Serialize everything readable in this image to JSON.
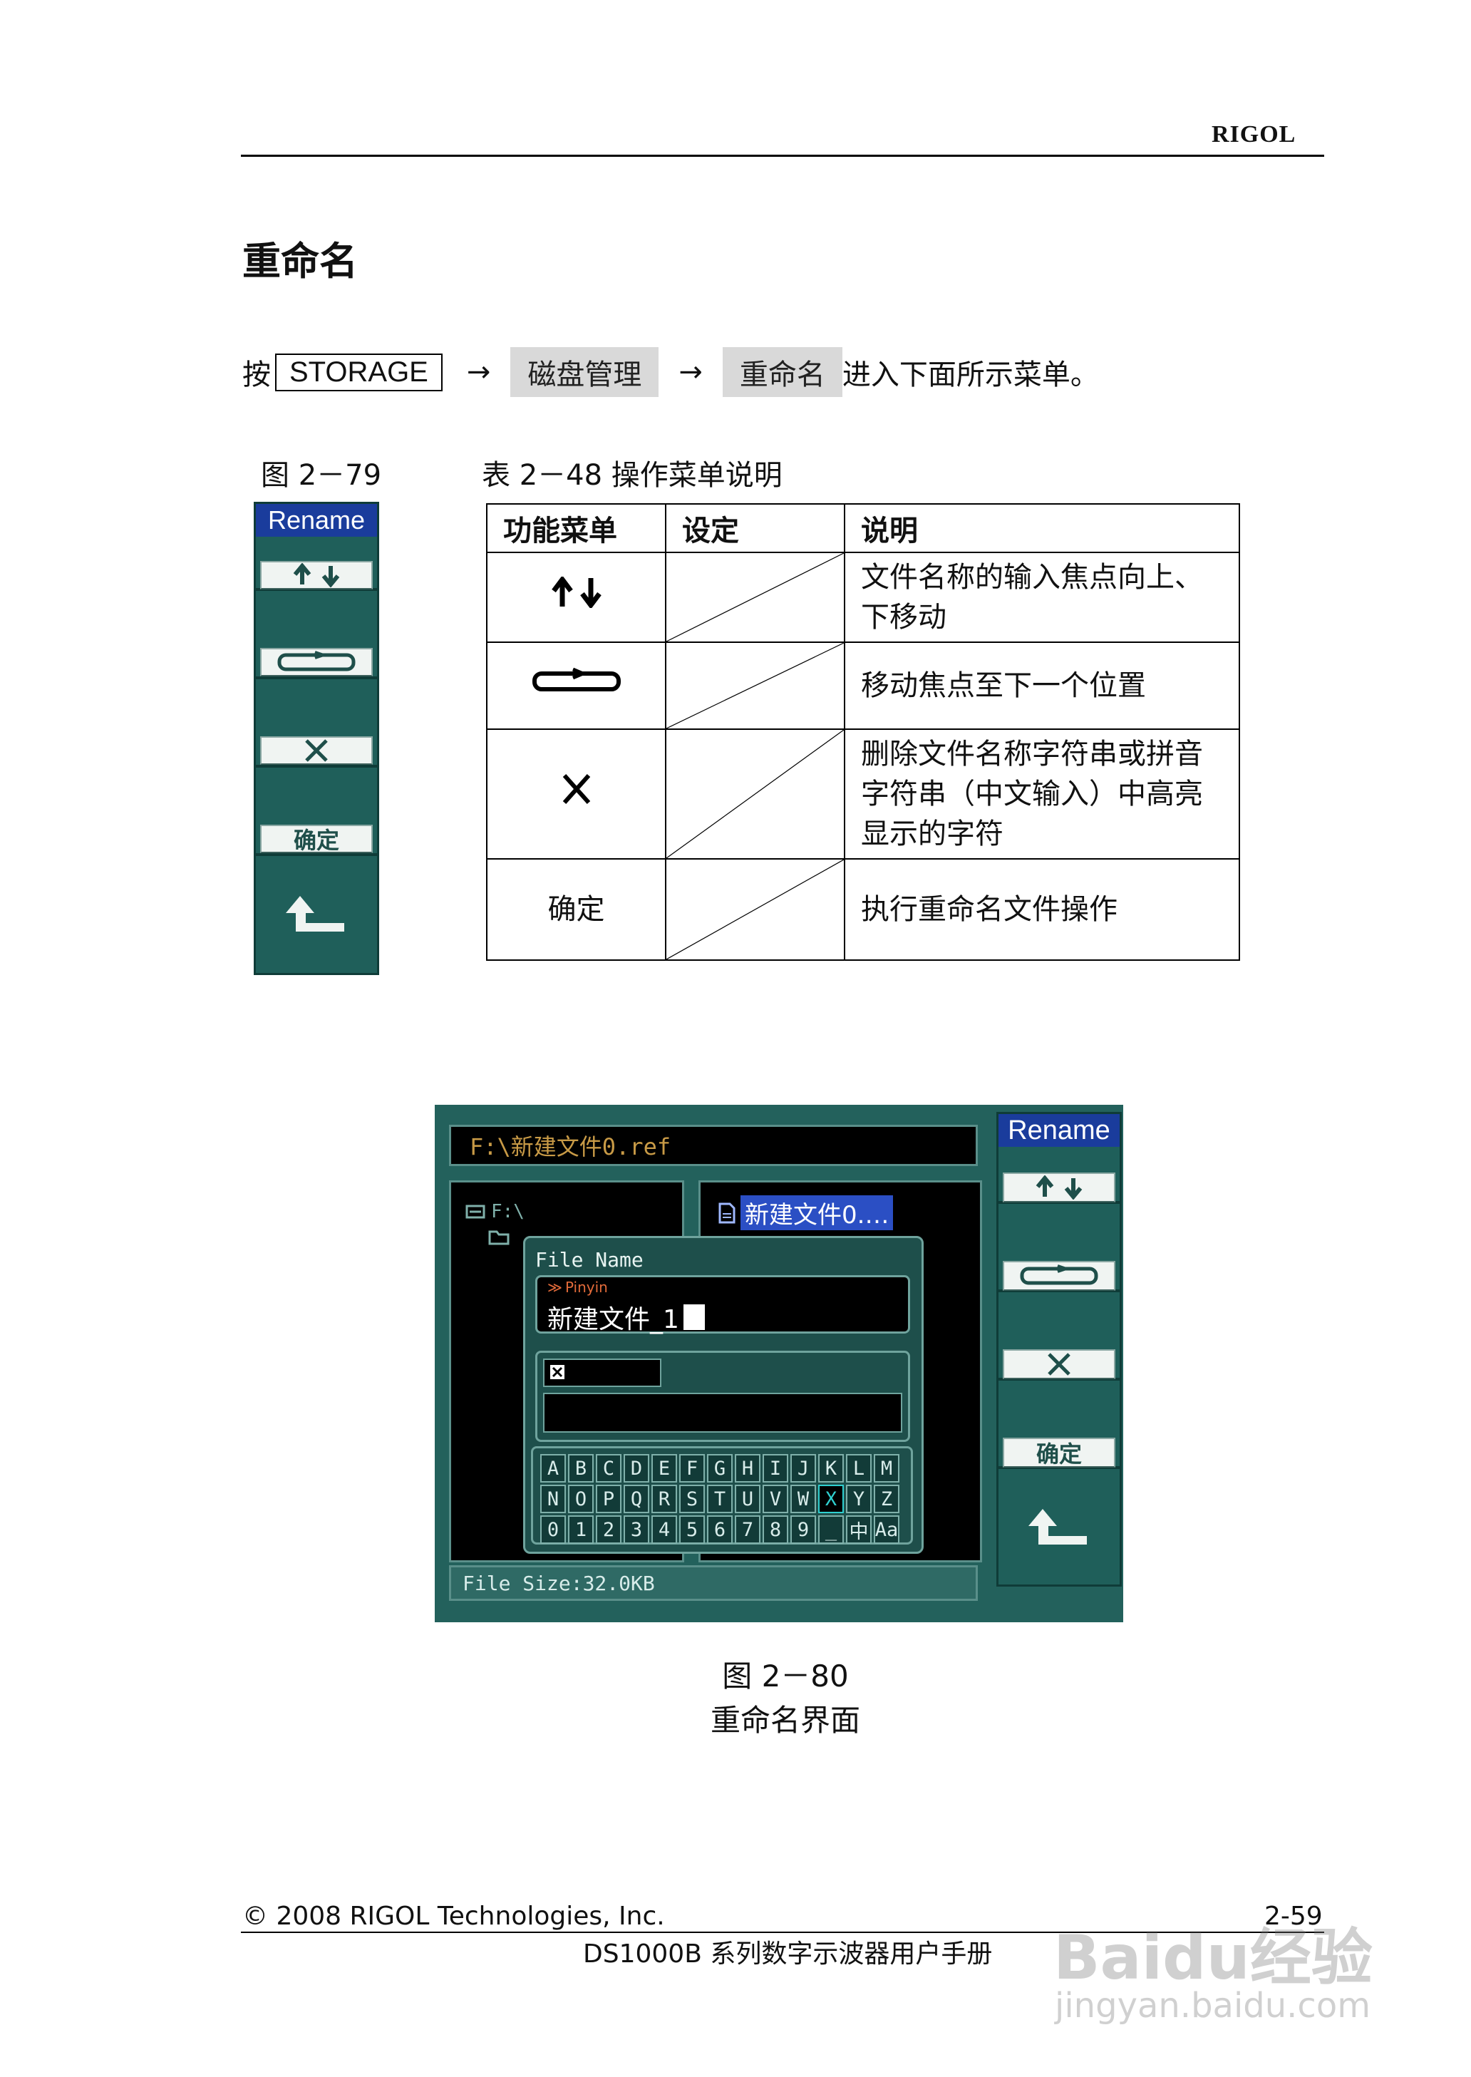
{
  "header": {
    "brand": "RIGOL"
  },
  "section_title": "重命名",
  "instruction": {
    "prefix": "按",
    "key": "STORAGE",
    "arrow1": "→",
    "menu1": "磁盘管理",
    "arrow2": "→",
    "menu2": "重命名",
    "suffix": "进入下面所示菜单。"
  },
  "figure_79": {
    "label": "图 2－79",
    "menu_title": "Rename",
    "items": [
      {
        "icon": "up-down-arrows-icon"
      },
      {
        "icon": "cycle-arrows-icon"
      },
      {
        "icon": "delete-x-icon"
      },
      {
        "label": "确定"
      },
      {
        "icon": "return-arrow-icon"
      }
    ]
  },
  "table_48": {
    "caption": "表 2－48  操作菜单说明",
    "headers": [
      "功能菜单",
      "设定",
      "说明"
    ],
    "rows": [
      {
        "func_icon": "up-down-arrows-icon",
        "desc": "文件名称的输入焦点向上、下移动"
      },
      {
        "func_icon": "cycle-arrows-icon",
        "desc": "移动焦点至下一个位置"
      },
      {
        "func_icon": "delete-x-icon",
        "desc": "删除文件名称字符串或拼音字符串（中文输入）中高亮显示的字符"
      },
      {
        "func": "确定",
        "desc": "执行重命名文件操作"
      }
    ]
  },
  "screen": {
    "path": "F:\\新建文件0.ref",
    "tree_root": "F:\\",
    "selected_file": "新建文件0.…",
    "dialog_title": "File Name",
    "input_mode": "Pinyin",
    "name_value": "新建文件_1",
    "keyboard_rows": [
      [
        "A",
        "B",
        "C",
        "D",
        "E",
        "F",
        "G",
        "H",
        "I",
        "J",
        "K",
        "L",
        "M"
      ],
      [
        "N",
        "O",
        "P",
        "Q",
        "R",
        "S",
        "T",
        "U",
        "V",
        "W",
        "X",
        "Y",
        "Z"
      ],
      [
        "0",
        "1",
        "2",
        "3",
        "4",
        "5",
        "6",
        "7",
        "8",
        "9",
        "_",
        "中",
        "Aa"
      ]
    ],
    "selected_key": "X",
    "file_size": "File Size:32.0KB",
    "menu_title": "Rename",
    "menu_confirm": "确定"
  },
  "figure_80": {
    "label": "图 2－80",
    "title": "重命名界面"
  },
  "footer": {
    "copyright": "© 2008 RIGOL Technologies, Inc.",
    "page": "2-59",
    "manual": "DS1000B 系列数字示波器用户手册"
  },
  "watermark": {
    "brand": "Baidu经验",
    "url": "jingyan.baidu.com"
  },
  "colors": {
    "menu_green": "#1f5f5a",
    "menu_title_blue": "#1a3c9c",
    "screen_path_text": "#c89a46",
    "selected_key": "#2fd0d0"
  }
}
